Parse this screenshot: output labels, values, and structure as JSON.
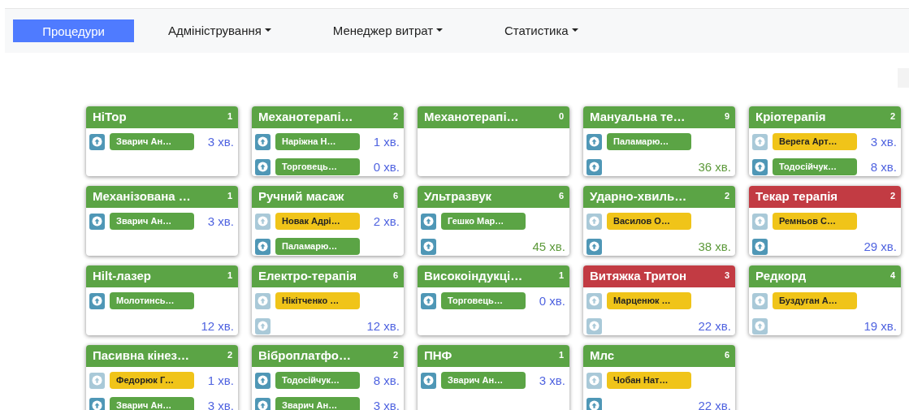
{
  "nav": {
    "items": [
      {
        "label": "Процедури",
        "selected": true,
        "dropdown": false
      },
      {
        "label": "Адміністрування",
        "selected": false,
        "dropdown": true
      },
      {
        "label": "Менеджер витрат",
        "selected": false,
        "dropdown": true
      },
      {
        "label": "Статистика",
        "selected": false,
        "dropdown": true
      }
    ]
  },
  "cards": [
    {
      "title": "НіТор",
      "count": "1",
      "color": "#5ba445",
      "entries": [
        {
          "dimmed": false,
          "chip": {
            "text": "Зварич Ан…",
            "color": "#5ba445"
          },
          "time": {
            "text": "3 хв.",
            "color": "#4f63e0"
          }
        }
      ]
    },
    {
      "title": "Механотерапі…",
      "count": "2",
      "color": "#5ba445",
      "entries": [
        {
          "dimmed": false,
          "chip": {
            "text": "Наріжна Н…",
            "color": "#5ba445"
          },
          "time": {
            "text": "1 хв.",
            "color": "#4f63e0"
          }
        },
        {
          "dimmed": false,
          "chip": {
            "text": "Торговець…",
            "color": "#5ba445"
          },
          "time": {
            "text": "0 хв.",
            "color": "#4f63e0"
          }
        }
      ]
    },
    {
      "title": "Механотерапі…",
      "count": "0",
      "color": "#5ba445"
    },
    {
      "title": "Мануальна те…",
      "count": "9",
      "color": "#5ba445",
      "entries": [
        {
          "dimmed": false,
          "chip": {
            "text": "Паламарю…",
            "color": "#5ba445"
          }
        },
        {
          "dimmed": false,
          "time": {
            "text": "36 хв.",
            "color": "#5e9a3c"
          }
        }
      ]
    },
    {
      "title": "Кріотерапія",
      "count": "2",
      "color": "#5ba445",
      "entries": [
        {
          "dimmed": true,
          "chip": {
            "text": "Верега Арт…",
            "color": "#f0c419"
          },
          "time": {
            "text": "3 хв.",
            "color": "#4f63e0"
          }
        },
        {
          "dimmed": false,
          "chip": {
            "text": "Тодосійчук…",
            "color": "#5ba445"
          },
          "time": {
            "text": "8 хв.",
            "color": "#4f63e0"
          }
        }
      ]
    },
    {
      "title": "Механізована …",
      "count": "1",
      "color": "#5ba445",
      "entries": [
        {
          "dimmed": false,
          "chip": {
            "text": "Зварич Ан…",
            "color": "#5ba445"
          },
          "time": {
            "text": "3 хв.",
            "color": "#4f63e0"
          }
        }
      ]
    },
    {
      "title": "Ручний масаж",
      "count": "6",
      "color": "#5ba445",
      "entries": [
        {
          "dimmed": true,
          "chip": {
            "text": "Новак Адрі…",
            "color": "#f0c419"
          },
          "time": {
            "text": "2 хв.",
            "color": "#4f63e0"
          }
        },
        {
          "dimmed": false,
          "chip": {
            "text": "Паламарю…",
            "color": "#5ba445"
          }
        }
      ]
    },
    {
      "title": "Ультразвук",
      "count": "6",
      "color": "#5ba445",
      "entries": [
        {
          "dimmed": false,
          "chip": {
            "text": "Гешко Мар…",
            "color": "#5ba445"
          }
        },
        {
          "dimmed": false,
          "time": {
            "text": "45 хв.",
            "color": "#5e9a3c"
          }
        }
      ]
    },
    {
      "title": "Ударно-хвиль…",
      "count": "2",
      "color": "#5ba445",
      "entries": [
        {
          "dimmed": true,
          "chip": {
            "text": "Василов О…",
            "color": "#f0c419"
          }
        },
        {
          "dimmed": false,
          "time": {
            "text": "38 хв.",
            "color": "#5e9a3c"
          }
        }
      ]
    },
    {
      "title": "Текар терапія",
      "count": "2",
      "color": "#c23b43",
      "entries": [
        {
          "dimmed": true,
          "chip": {
            "text": "Ремньов С…",
            "color": "#f0c419"
          }
        },
        {
          "dimmed": false,
          "time": {
            "text": "29 хв.",
            "color": "#4f63e0"
          }
        }
      ]
    },
    {
      "title": "Hilt-лазер",
      "count": "1",
      "color": "#5ba445",
      "entries": [
        {
          "dimmed": false,
          "chip": {
            "text": "Молотинсь…",
            "color": "#5ba445"
          }
        },
        {
          "time": {
            "text": "12 хв.",
            "color": "#4f63e0"
          }
        }
      ]
    },
    {
      "title": "Електро-терапія",
      "count": "6",
      "color": "#5ba445",
      "entries": [
        {
          "dimmed": true,
          "chip": {
            "text": "Нікітченко …",
            "color": "#f0c419"
          }
        },
        {
          "dimmed": true,
          "time": {
            "text": "12 хв.",
            "color": "#4f63e0"
          }
        }
      ]
    },
    {
      "title": "Високоіндукці…",
      "count": "1",
      "color": "#5ba445",
      "entries": [
        {
          "dimmed": false,
          "chip": {
            "text": "Торговець…",
            "color": "#5ba445"
          },
          "time": {
            "text": "0 хв.",
            "color": "#4f63e0"
          }
        }
      ]
    },
    {
      "title": "Витяжка Тритон",
      "count": "3",
      "color": "#c23b43",
      "entries": [
        {
          "dimmed": true,
          "chip": {
            "text": "Марценюк …",
            "color": "#f0c419"
          }
        },
        {
          "dimmed": true,
          "time": {
            "text": "22 хв.",
            "color": "#4f63e0"
          }
        }
      ]
    },
    {
      "title": "Редкорд",
      "count": "4",
      "color": "#5ba445",
      "entries": [
        {
          "dimmed": true,
          "chip": {
            "text": "Буздуган А…",
            "color": "#f0c419"
          }
        },
        {
          "dimmed": true,
          "time": {
            "text": "19 хв.",
            "color": "#4f63e0"
          }
        }
      ]
    },
    {
      "title": "Пасивна кінез…",
      "count": "2",
      "color": "#5ba445",
      "entries": [
        {
          "dimmed": true,
          "chip": {
            "text": "Федорюк Г…",
            "color": "#f0c419"
          },
          "time": {
            "text": "1 хв.",
            "color": "#4f63e0"
          }
        },
        {
          "dimmed": false,
          "chip": {
            "text": "Зварич Ан…",
            "color": "#5ba445"
          },
          "time": {
            "text": "3 хв.",
            "color": "#4f63e0"
          }
        }
      ]
    },
    {
      "title": "Віброплатфо…",
      "count": "2",
      "color": "#5ba445",
      "entries": [
        {
          "dimmed": false,
          "chip": {
            "text": "Тодосійчук…",
            "color": "#5ba445"
          },
          "time": {
            "text": "8 хв.",
            "color": "#4f63e0"
          }
        },
        {
          "dimmed": false,
          "chip": {
            "text": "Зварич Ан…",
            "color": "#5ba445"
          },
          "time": {
            "text": "3 хв.",
            "color": "#4f63e0"
          }
        }
      ]
    },
    {
      "title": "ПНФ",
      "count": "1",
      "color": "#5ba445",
      "entries": [
        {
          "dimmed": false,
          "chip": {
            "text": "Зварич Ан…",
            "color": "#5ba445"
          },
          "time": {
            "text": "3 хв.",
            "color": "#4f63e0"
          }
        }
      ]
    },
    {
      "title": "Млс",
      "count": "6",
      "color": "#5ba445",
      "entries": [
        {
          "dimmed": true,
          "chip": {
            "text": "Чобан Нат…",
            "color": "#f0c419"
          }
        },
        {
          "dimmed": false,
          "time": {
            "text": "22 хв.",
            "color": "#4f63e0"
          }
        }
      ]
    }
  ]
}
